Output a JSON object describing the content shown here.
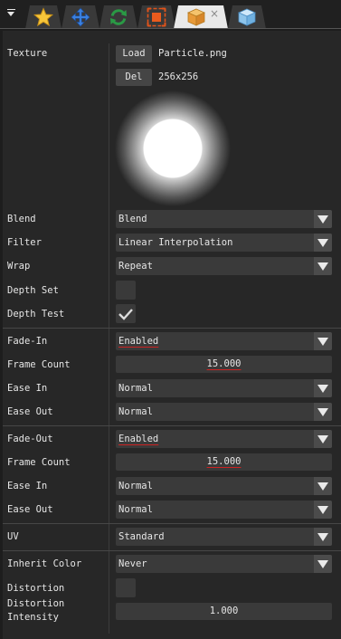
{
  "tabs": [
    {
      "icon": "star-icon",
      "active": false
    },
    {
      "icon": "move-icon",
      "active": false
    },
    {
      "icon": "rotate-icon",
      "active": false
    },
    {
      "icon": "scale-icon",
      "active": false
    },
    {
      "icon": "box-icon",
      "active": true,
      "close_label": "×"
    },
    {
      "icon": "cube-icon",
      "active": false
    }
  ],
  "texture": {
    "label": "Texture",
    "load_label": "Load",
    "file_name": "Particle.png",
    "delete_label": "Del",
    "size": "256x256"
  },
  "render": {
    "blend": {
      "label": "Blend",
      "value": "Blend"
    },
    "filter": {
      "label": "Filter",
      "value": "Linear Interpolation"
    },
    "wrap": {
      "label": "Wrap",
      "value": "Repeat"
    },
    "depth_set": {
      "label": "Depth Set",
      "checked": false
    },
    "depth_test": {
      "label": "Depth Test",
      "checked": true
    }
  },
  "fade_in": {
    "label": "Fade-In",
    "value": "Enabled",
    "frame_count_label": "Frame Count",
    "frame_count": "15.000",
    "ease_in_label": "Ease In",
    "ease_in": "Normal",
    "ease_out_label": "Ease Out",
    "ease_out": "Normal"
  },
  "fade_out": {
    "label": "Fade-Out",
    "value": "Enabled",
    "frame_count_label": "Frame Count",
    "frame_count": "15.000",
    "ease_in_label": "Ease In",
    "ease_in": "Normal",
    "ease_out_label": "Ease Out",
    "ease_out": "Normal"
  },
  "uv": {
    "label": "UV",
    "value": "Standard"
  },
  "color": {
    "inherit_label": "Inherit Color",
    "inherit_value": "Never",
    "distortion_label": "Distortion",
    "distortion_checked": false,
    "intensity_label_1": "Distortion",
    "intensity_label_2": "Intensity",
    "intensity_value": "1.000"
  },
  "colors": {
    "background": "#1d1d1d",
    "panel": "#272727",
    "widget": "#3a3a3a",
    "active_tab": "#e9e9e9",
    "modified_underline": "#cc2222"
  }
}
